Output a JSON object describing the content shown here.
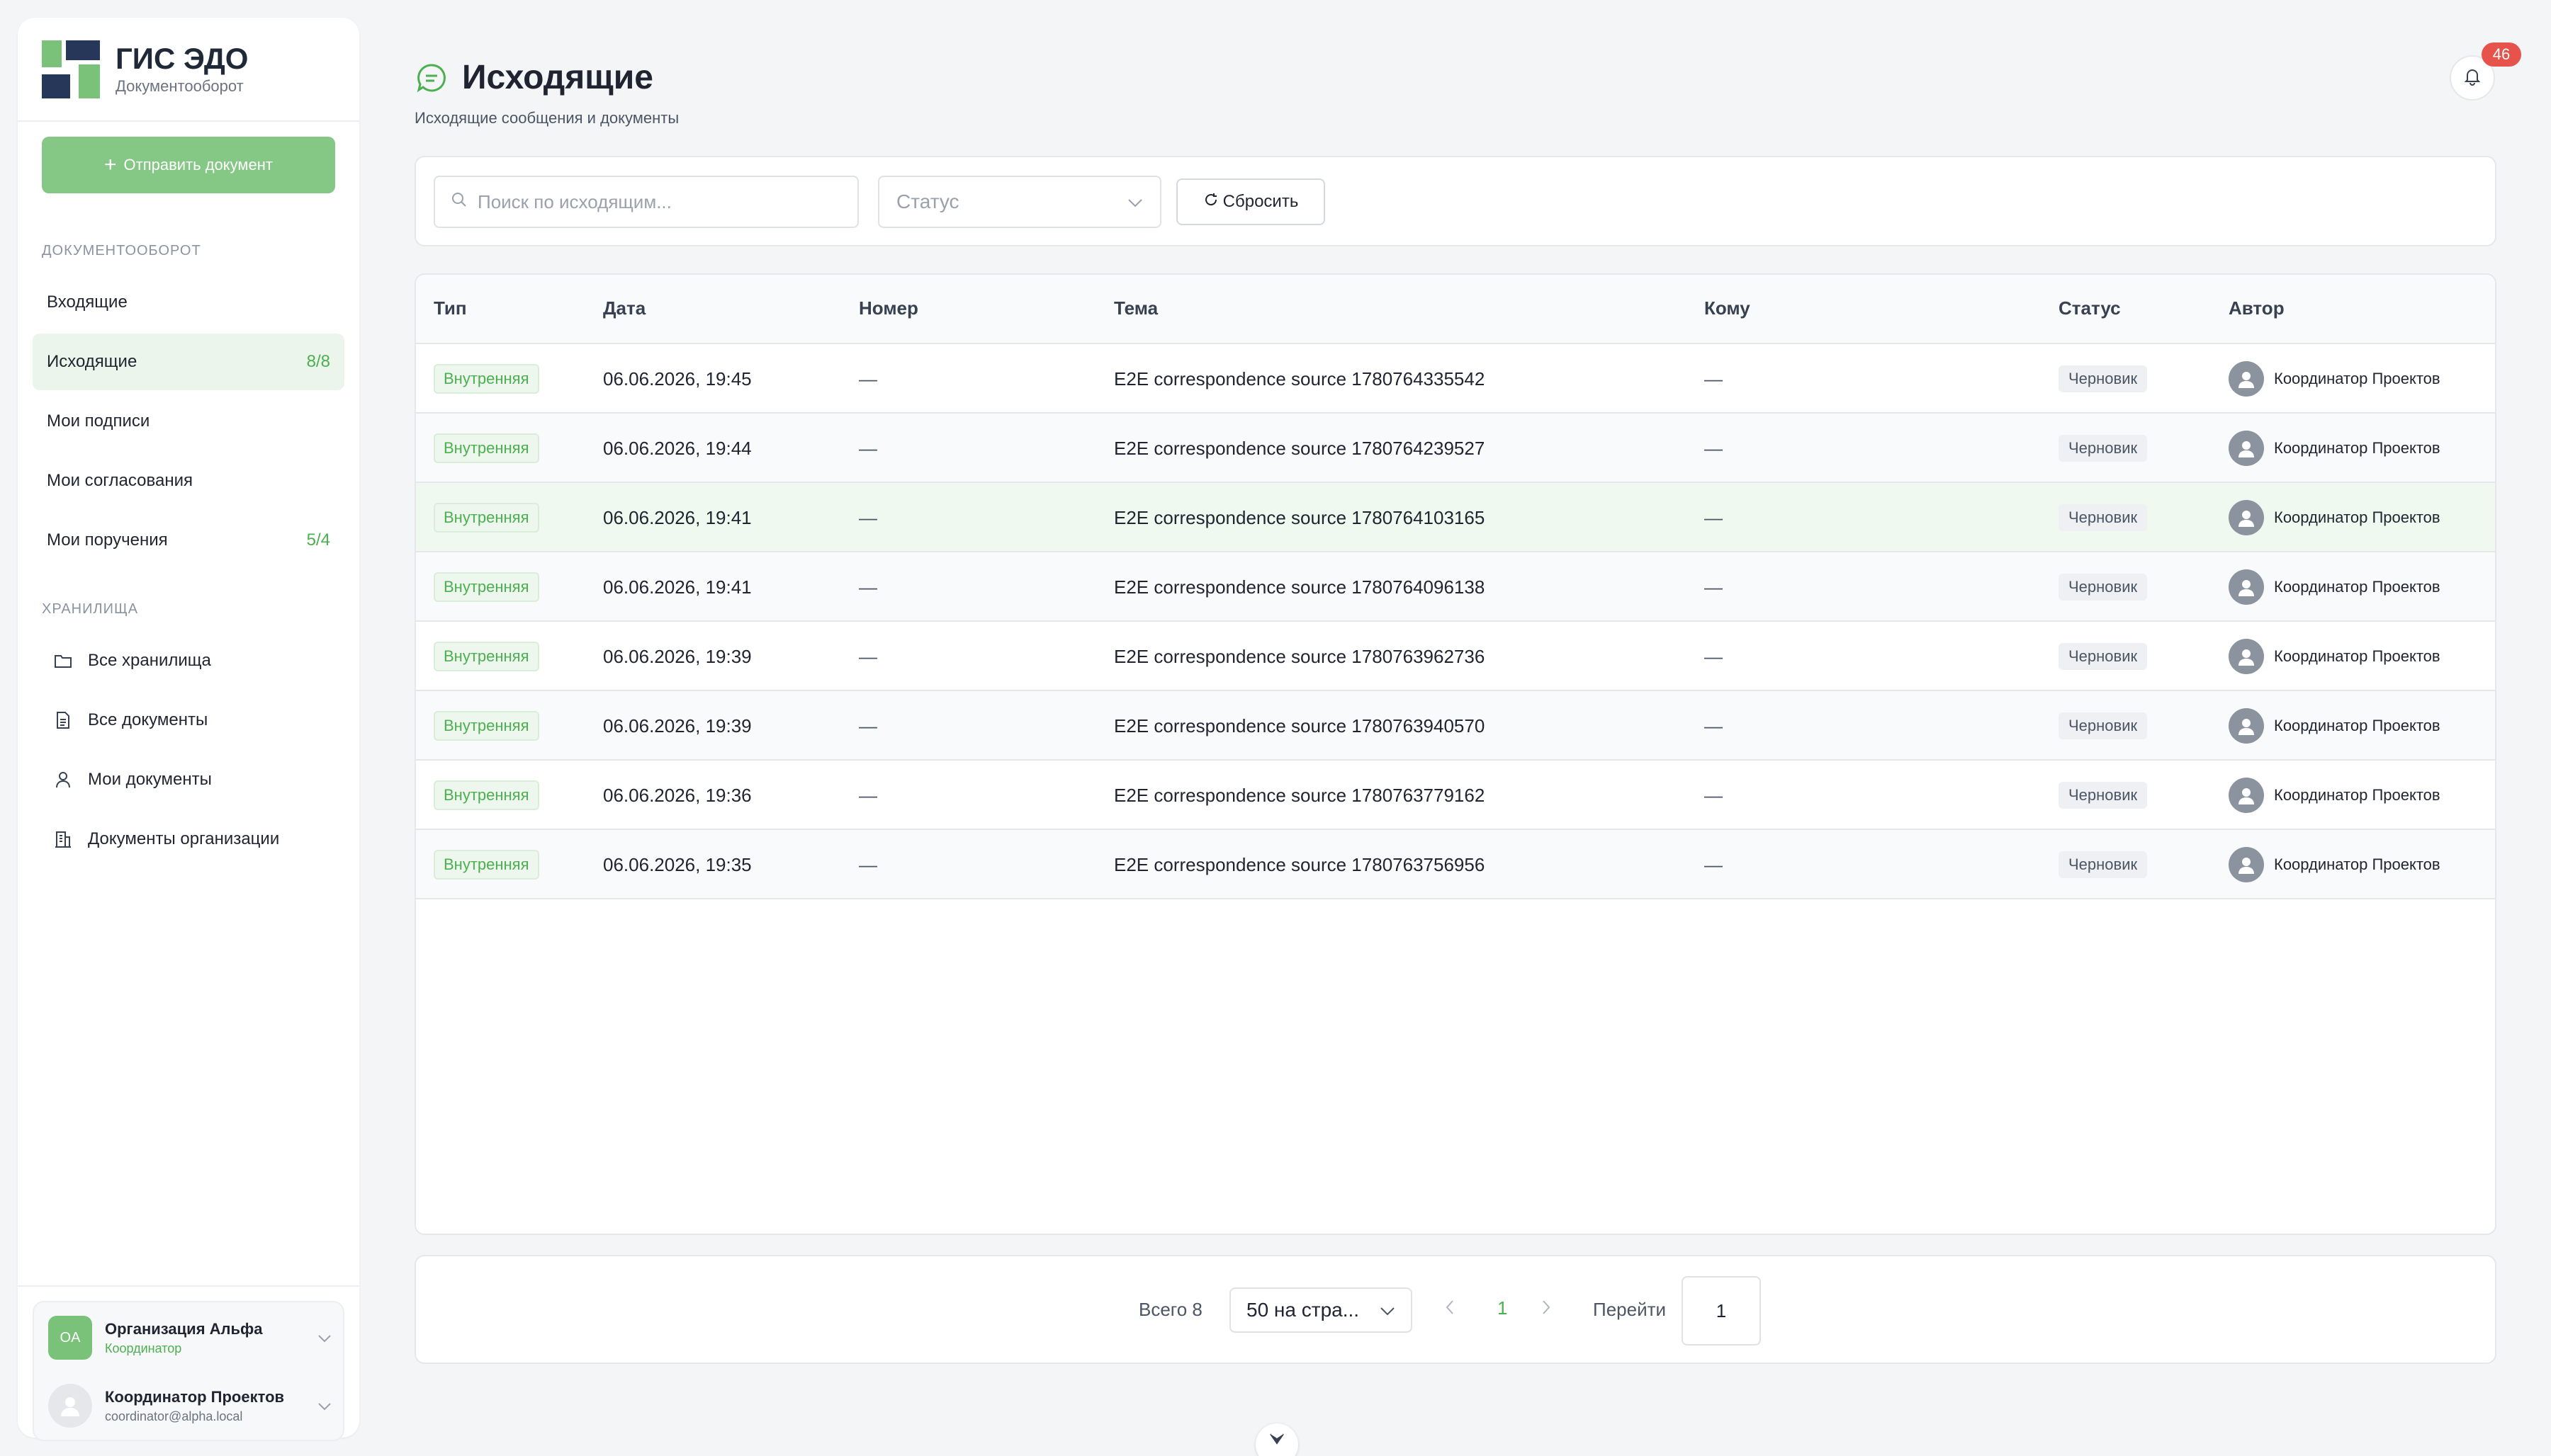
{
  "brand": {
    "title": "ГИС ЭДО",
    "subtitle": "Документооборот"
  },
  "sidebar": {
    "send_button": "Отправить документ",
    "section_docflow": "ДОКУМЕНТООБОРОТ",
    "docflow_items": [
      {
        "label": "Входящие",
        "count": ""
      },
      {
        "label": "Исходящие",
        "count": "8/8"
      },
      {
        "label": "Мои подписи",
        "count": ""
      },
      {
        "label": "Мои согласования",
        "count": ""
      },
      {
        "label": "Мои поручения",
        "count": "5/4"
      }
    ],
    "section_storage": "ХРАНИЛИЩА",
    "storage_items": [
      {
        "label": "Все хранилища",
        "icon": "folder-icon"
      },
      {
        "label": "Все документы",
        "icon": "document-icon"
      },
      {
        "label": "Мои документы",
        "icon": "user-icon"
      },
      {
        "label": "Документы организации",
        "icon": "building-icon"
      }
    ],
    "org": {
      "initials": "OA",
      "name": "Организация Альфа",
      "role": "Координатор"
    },
    "user": {
      "name": "Координатор Проектов",
      "email": "coordinator@alpha.local"
    }
  },
  "header": {
    "title": "Исходящие",
    "subtitle": "Исходящие сообщения и документы",
    "notifications": "46"
  },
  "filters": {
    "search_placeholder": "Поиск по исходящим...",
    "status_placeholder": "Статус",
    "reset_label": "Сбросить"
  },
  "table": {
    "columns": [
      "Тип",
      "Дата",
      "Номер",
      "Тема",
      "Кому",
      "Статус",
      "Автор"
    ],
    "rows": [
      {
        "type": "Внутренняя",
        "date": "06.06.2026, 19:45",
        "number": "—",
        "subject": "E2E correspondence source 1780764335542",
        "to": "—",
        "status": "Черновик",
        "author": "Координатор Проектов"
      },
      {
        "type": "Внутренняя",
        "date": "06.06.2026, 19:44",
        "number": "—",
        "subject": "E2E correspondence source 1780764239527",
        "to": "—",
        "status": "Черновик",
        "author": "Координатор Проектов"
      },
      {
        "type": "Внутренняя",
        "date": "06.06.2026, 19:41",
        "number": "—",
        "subject": "E2E correspondence source 1780764103165",
        "to": "—",
        "status": "Черновик",
        "author": "Координатор Проектов"
      },
      {
        "type": "Внутренняя",
        "date": "06.06.2026, 19:41",
        "number": "—",
        "subject": "E2E correspondence source 1780764096138",
        "to": "—",
        "status": "Черновик",
        "author": "Координатор Проектов"
      },
      {
        "type": "Внутренняя",
        "date": "06.06.2026, 19:39",
        "number": "—",
        "subject": "E2E correspondence source 1780763962736",
        "to": "—",
        "status": "Черновик",
        "author": "Координатор Проектов"
      },
      {
        "type": "Внутренняя",
        "date": "06.06.2026, 19:39",
        "number": "—",
        "subject": "E2E correspondence source 1780763940570",
        "to": "—",
        "status": "Черновик",
        "author": "Координатор Проектов"
      },
      {
        "type": "Внутренняя",
        "date": "06.06.2026, 19:36",
        "number": "—",
        "subject": "E2E correspondence source 1780763779162",
        "to": "—",
        "status": "Черновик",
        "author": "Координатор Проектов"
      },
      {
        "type": "Внутренняя",
        "date": "06.06.2026, 19:35",
        "number": "—",
        "subject": "E2E correspondence source 1780763756956",
        "to": "—",
        "status": "Черновик",
        "author": "Координатор Проектов"
      }
    ]
  },
  "pagination": {
    "total_label": "Всего 8",
    "page_size": "50 на стра...",
    "current_page": "1",
    "goto_label": "Перейти",
    "goto_value": "1"
  },
  "colors": {
    "accent": "#4caf50",
    "brand_navy": "#263759",
    "badge": "#e5534b"
  }
}
